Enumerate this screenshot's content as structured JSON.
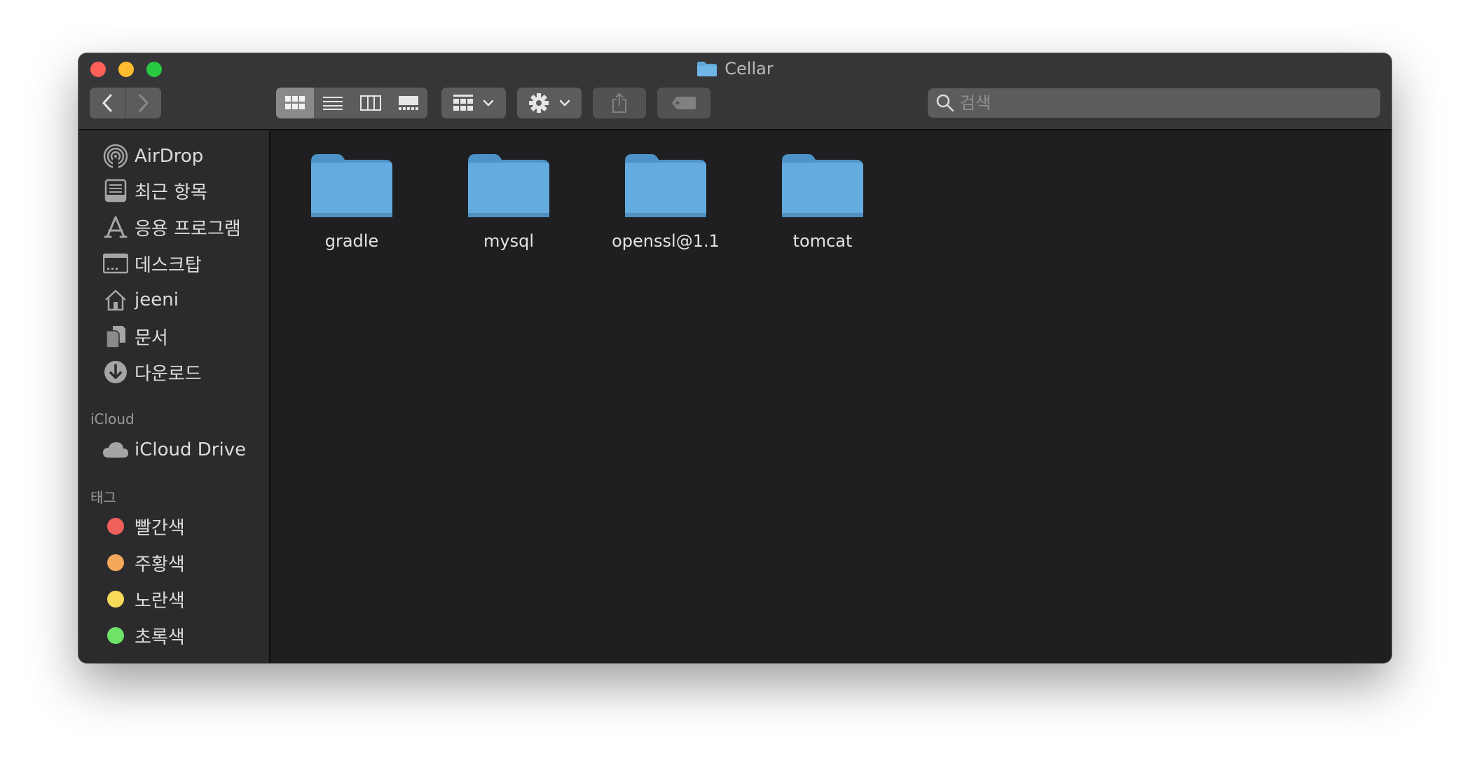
{
  "window": {
    "title": "Cellar"
  },
  "toolbar": {
    "back_icon": "chevron-left-icon",
    "forward_icon": "chevron-right-icon",
    "view_modes": [
      "icon-view",
      "list-view",
      "column-view",
      "gallery-view"
    ],
    "active_view": "icon-view",
    "group_icon": "grid-icon",
    "action_icon": "gear-icon",
    "share_icon": "share-icon",
    "tag_icon": "tag-icon"
  },
  "search": {
    "placeholder": "검색",
    "value": ""
  },
  "sidebar": {
    "favorites": [
      {
        "label": "AirDrop",
        "icon": "airdrop-icon"
      },
      {
        "label": "최근 항목",
        "icon": "recents-icon"
      },
      {
        "label": "응용 프로그램",
        "icon": "applications-icon"
      },
      {
        "label": "데스크탑",
        "icon": "desktop-icon"
      },
      {
        "label": "jeeni",
        "icon": "home-icon"
      },
      {
        "label": "문서",
        "icon": "documents-icon"
      },
      {
        "label": "다운로드",
        "icon": "downloads-icon"
      }
    ],
    "icloud_label": "iCloud",
    "icloud": [
      {
        "label": "iCloud Drive",
        "icon": "cloud-icon"
      }
    ],
    "tags_label": "태그",
    "tags": [
      {
        "label": "빨간색",
        "color": "#f0605a"
      },
      {
        "label": "주황색",
        "color": "#f5a85a"
      },
      {
        "label": "노란색",
        "color": "#f8d95a"
      },
      {
        "label": "초록색",
        "color": "#6ee368"
      }
    ]
  },
  "files": [
    {
      "name": "gradle",
      "icon": "folder-icon"
    },
    {
      "name": "mysql",
      "icon": "folder-icon"
    },
    {
      "name": "openssl@1.1",
      "icon": "folder-icon"
    },
    {
      "name": "tomcat",
      "icon": "folder-icon"
    }
  ],
  "colors": {
    "folder": "#5fa8dc",
    "close": "#fe5f57",
    "minimize": "#febc2e",
    "maximize": "#28c840"
  }
}
